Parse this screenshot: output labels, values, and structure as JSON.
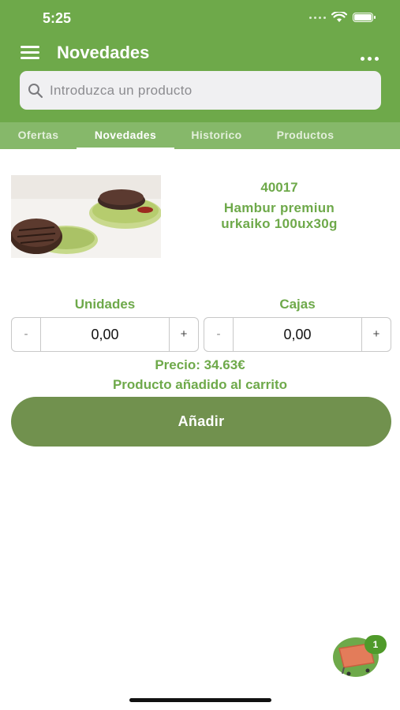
{
  "status_bar": {
    "time": "5:25"
  },
  "header": {
    "title": "Novedades"
  },
  "search": {
    "placeholder": "Introduzca un producto",
    "value": ""
  },
  "tabs": [
    {
      "label": "Ofertas",
      "active": false
    },
    {
      "label": "Novedades",
      "active": true
    },
    {
      "label": "Historico",
      "active": false
    },
    {
      "label": "Productos",
      "active": false
    }
  ],
  "product": {
    "code": "40017",
    "name_line1": "Hambur premiun",
    "name_line2": "urkaiko 100ux30g"
  },
  "quantity": {
    "units_label": "Unidades",
    "boxes_label": "Cajas",
    "units_value": "0,00",
    "boxes_value": "0,00",
    "minus": "-",
    "plus": "+"
  },
  "price_text": "Precio: 34.63€",
  "status_message": "Producto añadido al carrito",
  "add_button_label": "Añadir",
  "cart": {
    "badge_count": "1"
  },
  "colors": {
    "brand_green": "#6ea94a",
    "tab_bar": "#86b86a",
    "add_button": "#71914e",
    "search_bg": "#f0f0f2"
  }
}
